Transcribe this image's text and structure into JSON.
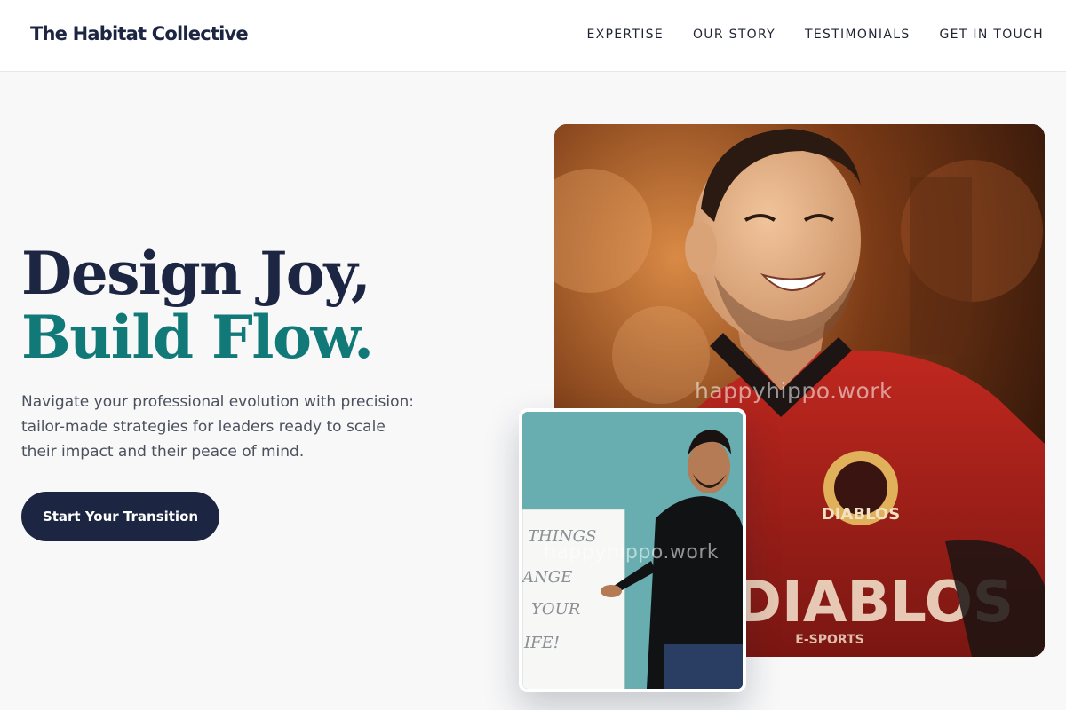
{
  "header": {
    "brand": "The Habitat Collective",
    "nav": [
      "EXPERTISE",
      "OUR STORY",
      "TESTIMONIALS",
      "GET IN TOUCH"
    ]
  },
  "hero": {
    "headline_line1": "Design Joy,",
    "headline_line2": "Build Flow.",
    "description": "Navigate your professional evolution with precision: tailor-made strategies for leaders ready to scale their impact and their peace of mind.",
    "cta_label": "Start Your Transition"
  },
  "images": {
    "main_photo": {
      "alt": "Smiling man in a red Diablos Esports jersey",
      "jersey_text": "DIABLOS",
      "jersey_subtext": "E-SPORTS",
      "watermark": "happyhippo.work"
    },
    "inset_photo": {
      "alt": "Man in black shirt presenting at a flip chart",
      "flipchart_text": [
        "THINGS",
        "ANGE",
        "YOUR",
        "IFE!"
      ],
      "watermark": "happyhippo.work"
    }
  },
  "colors": {
    "navy": "#1c2541",
    "teal": "#117a78",
    "background": "#f8f8f9",
    "jersey_red": "#b3221d",
    "inset_bg": "#68aeb0"
  }
}
